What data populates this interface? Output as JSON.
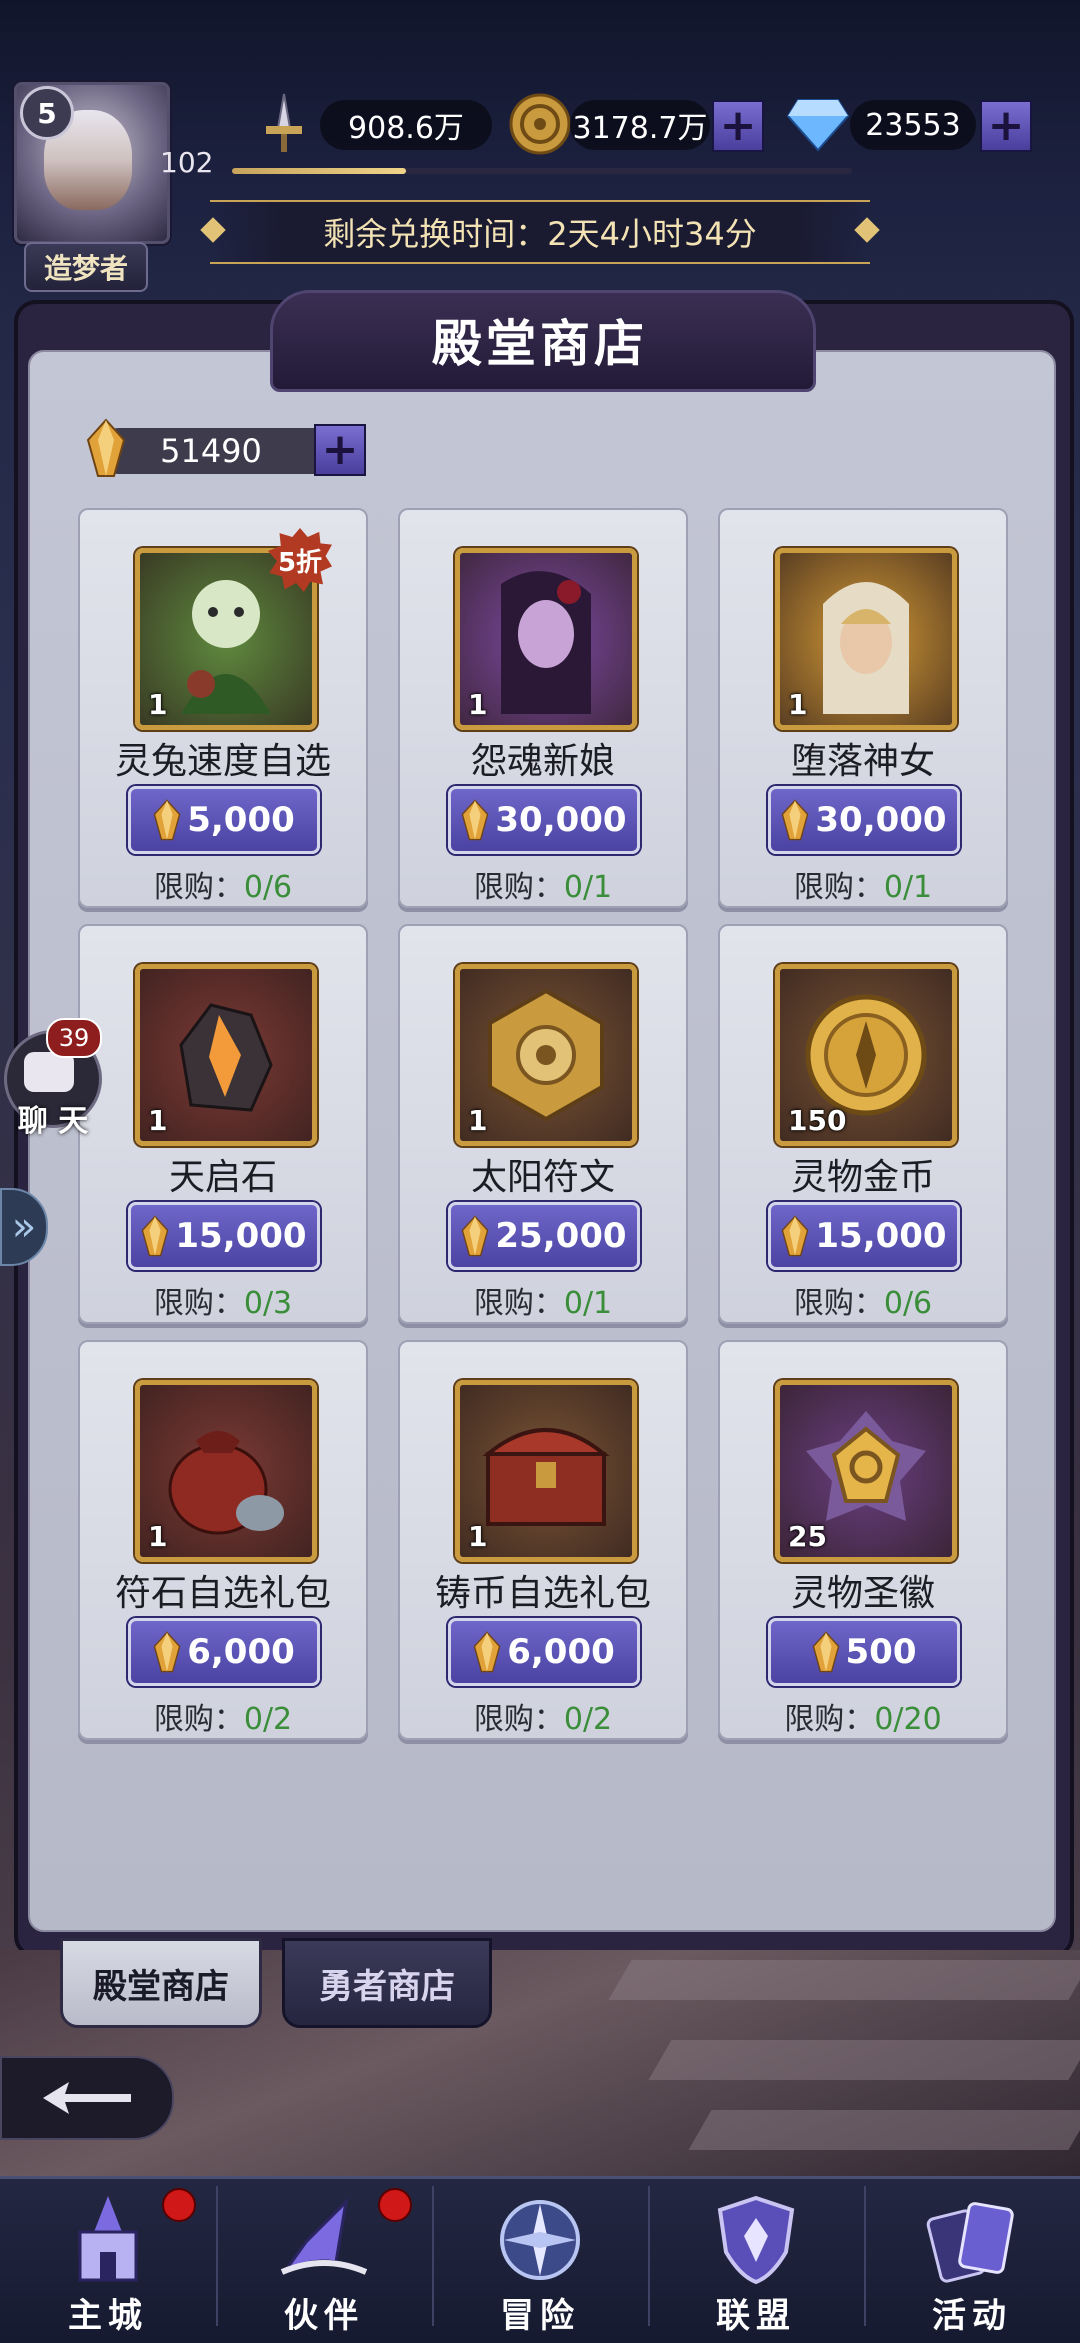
{
  "player": {
    "level": "5",
    "xp": "102",
    "xp_fraction": 0.28,
    "title": "造梦者"
  },
  "resources": {
    "power": "908.6万",
    "gold": "3178.7万",
    "diamonds": "23553",
    "plus": "+"
  },
  "timer": {
    "label": "剩余兑换时间：2天4小时34分"
  },
  "shop": {
    "title": "殿堂商店",
    "currency_amount": "51490"
  },
  "items": [
    {
      "name": "灵兔速度自选",
      "qty": "1",
      "price": "5,000",
      "limit_label": "限购：",
      "limit_value": "0/6",
      "discount": "5折",
      "icon": "hero-green-icon",
      "bg": "#5f8a3e"
    },
    {
      "name": "怨魂新娘",
      "qty": "1",
      "price": "30,000",
      "limit_label": "限购：",
      "limit_value": "0/1",
      "discount": "",
      "icon": "hero-purple-icon",
      "bg": "#7d4aa3"
    },
    {
      "name": "堕落神女",
      "qty": "1",
      "price": "30,000",
      "limit_label": "限购：",
      "limit_value": "0/1",
      "discount": "",
      "icon": "hero-gold-icon",
      "bg": "#d49a36"
    },
    {
      "name": "天启石",
      "qty": "1",
      "price": "15,000",
      "limit_label": "限购：",
      "limit_value": "0/3",
      "discount": "",
      "icon": "stone-icon",
      "bg": "#7d3a34"
    },
    {
      "name": "太阳符文",
      "qty": "1",
      "price": "25,000",
      "limit_label": "限购：",
      "limit_value": "0/1",
      "discount": "",
      "icon": "sun-rune-icon",
      "bg": "#7a5535"
    },
    {
      "name": "灵物金币",
      "qty": "150",
      "price": "15,000",
      "limit_label": "限购：",
      "limit_value": "0/6",
      "discount": "",
      "icon": "coin-icon",
      "bg": "#7a5535"
    },
    {
      "name": "符石自选礼包",
      "qty": "1",
      "price": "6,000",
      "limit_label": "限购：",
      "limit_value": "0/2",
      "discount": "",
      "icon": "bag-icon",
      "bg": "#7d3a34"
    },
    {
      "name": "铸币自选礼包",
      "qty": "1",
      "price": "6,000",
      "limit_label": "限购：",
      "limit_value": "0/2",
      "discount": "",
      "icon": "chest-icon",
      "bg": "#7a5535"
    },
    {
      "name": "灵物圣徽",
      "qty": "25",
      "price": "500",
      "limit_label": "限购：",
      "limit_value": "0/20",
      "discount": "",
      "icon": "emblem-icon",
      "bg": "#6a3f82"
    }
  ],
  "chat": {
    "count": "39",
    "label": "聊 天"
  },
  "tabs": [
    {
      "label": "殿堂商店",
      "active": true
    },
    {
      "label": "勇者商店",
      "active": false
    }
  ],
  "nav": [
    {
      "label": "主城",
      "icon": "castle-icon",
      "badge": true
    },
    {
      "label": "伙伴",
      "icon": "wizard-hat-icon",
      "badge": true
    },
    {
      "label": "冒险",
      "icon": "compass-icon",
      "badge": false
    },
    {
      "label": "联盟",
      "icon": "shield-icon",
      "badge": false
    },
    {
      "label": "活动",
      "icon": "cards-icon",
      "badge": false
    }
  ],
  "colors": {
    "accent_purple": "#5a52b8",
    "gold": "#c99b3e",
    "limit_green": "#3a8e3a",
    "badge_red": "#d01818"
  }
}
